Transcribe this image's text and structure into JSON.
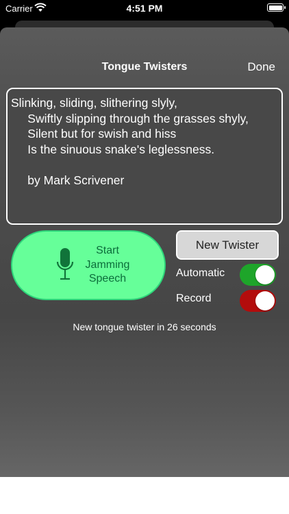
{
  "status_bar": {
    "carrier": "Carrier",
    "time": "4:51 PM",
    "battery_level": 1.0
  },
  "nav": {
    "title": "Tongue Twisters",
    "done_label": "Done"
  },
  "twister": {
    "text": "Slinking, sliding, slithering slyly,\n     Swiftly slipping through the grasses shyly,\n     Silent but for swish and hiss\n     Is the sinuous snake's leglessness.\n\n     by Mark Scrivener"
  },
  "speech_button": {
    "label": "Start\nJamming\nSpeech",
    "icon": "microphone-icon"
  },
  "new_twister_button": {
    "label": "New Twister"
  },
  "toggles": {
    "automatic": {
      "label": "Automatic",
      "on": true,
      "color": "#1ea52a"
    },
    "record": {
      "label": "Record",
      "on": true,
      "color": "#b30c0c"
    }
  },
  "timer_text": "New tongue twister in 26 seconds",
  "colors": {
    "speech_fill": "#66ff99",
    "speech_text": "#0b6d3a",
    "button_gray": "#d7d7d7"
  }
}
